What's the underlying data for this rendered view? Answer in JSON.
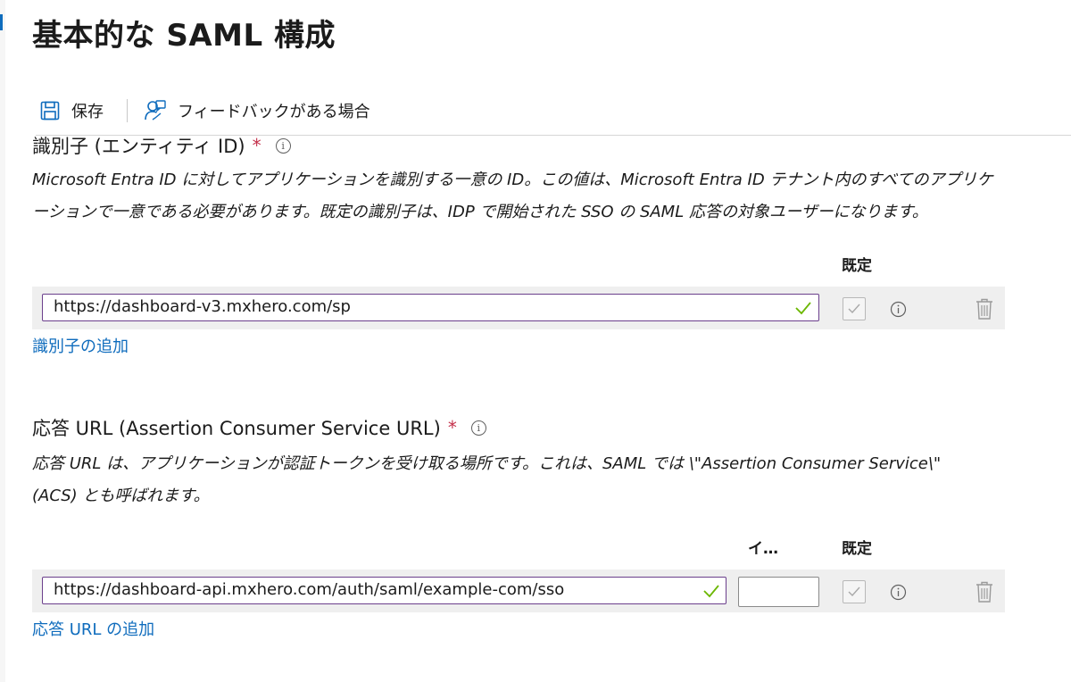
{
  "page": {
    "title": "基本的な SAML 構成"
  },
  "toolbar": {
    "save_label": "保存",
    "feedback_label": "フィードバックがある場合"
  },
  "identifier": {
    "title": "識別子 (エンティティ ID)",
    "required_mark": "*",
    "description": "Microsoft Entra ID に対してアプリケーションを識別する一意の ID。この値は、Microsoft Entra ID テナント内のすべてのアプリケーションで一意である必要があります。既定の識別子は、IDP で開始された SSO の SAML 応答の対象ユーザーになります。",
    "col_default": "既定",
    "value": "https://dashboard-v3.mxhero.com/sp",
    "add_link": "識別子の追加"
  },
  "reply_url": {
    "title": "応答 URL (Assertion Consumer Service URL)",
    "required_mark": "*",
    "description": "応答 URL は、アプリケーションが認証トークンを受け取る場所です。これは、SAML では \\\"Assertion Consumer Service\\\" (ACS) とも呼ばれます。",
    "col_index": "イ…",
    "col_default": "既定",
    "value": "https://dashboard-api.mxhero.com/auth/saml/example-com/sso",
    "index_value": "",
    "add_link": "応答 URL の追加"
  },
  "colors": {
    "accent": "#0f6cbd",
    "required": "#c4314b",
    "valid_check": "#6bb700",
    "input_border": "#6b3f8c"
  },
  "icons": [
    "save-icon",
    "feedback-icon",
    "info-icon",
    "checkmark-icon",
    "checkbox-icon",
    "trash-icon"
  ]
}
